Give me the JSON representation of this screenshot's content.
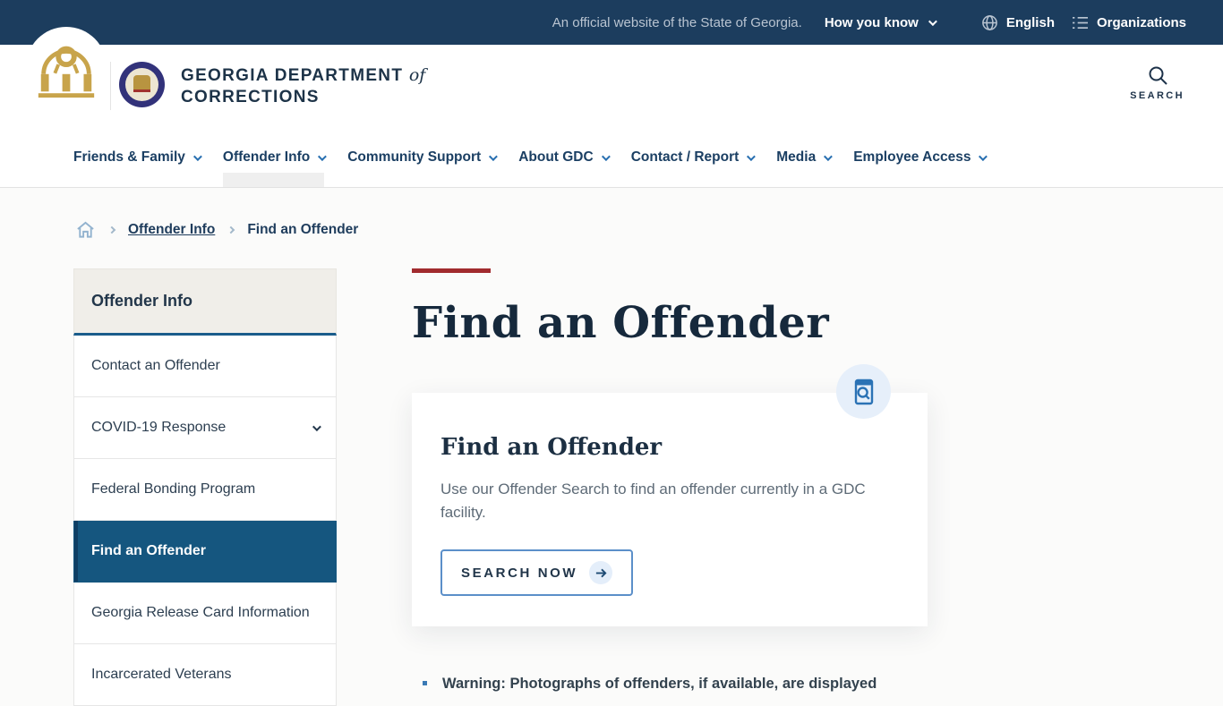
{
  "colors": {
    "topbar_bg": "#1C3D5E",
    "brand_navy": "#1D3348",
    "accent_red": "#A12B2E",
    "active_blue": "#15567F",
    "link_blue": "#2A72B5",
    "gold": "#C8A44B"
  },
  "topbar": {
    "official_text": "An official website of the State of Georgia.",
    "how_you_know": "How you know",
    "language_label": "English",
    "organizations_label": "Organizations"
  },
  "header": {
    "agency_name_line1": "GEORGIA DEPARTMENT",
    "agency_of": "of",
    "agency_name_line2": "CORRECTIONS",
    "search_label": "SEARCH"
  },
  "nav": {
    "active": "Offender Info",
    "items": [
      {
        "label": "Friends & Family"
      },
      {
        "label": "Offender Info"
      },
      {
        "label": "Community Support"
      },
      {
        "label": "About GDC"
      },
      {
        "label": "Contact / Report"
      },
      {
        "label": "Media"
      },
      {
        "label": "Employee Access"
      }
    ]
  },
  "breadcrumb": {
    "link": "Offender Info",
    "current": "Find an Offender"
  },
  "sidebar": {
    "title": "Offender Info",
    "active": "Find an Offender",
    "items": [
      {
        "label": "Contact an Offender"
      },
      {
        "label": "COVID-19 Response"
      },
      {
        "label": "Federal Bonding Program"
      },
      {
        "label": "Find an Offender"
      },
      {
        "label": "Georgia Release Card Information"
      },
      {
        "label": "Incarcerated Veterans"
      }
    ]
  },
  "main": {
    "page_title": "Find an Offender",
    "card": {
      "title": "Find an Offender",
      "description": "Use our Offender Search to find an offender currently in a GDC facility.",
      "button_label": "SEARCH NOW"
    },
    "warning_text": "Warning: Photographs of offenders, if available, are displayed"
  }
}
